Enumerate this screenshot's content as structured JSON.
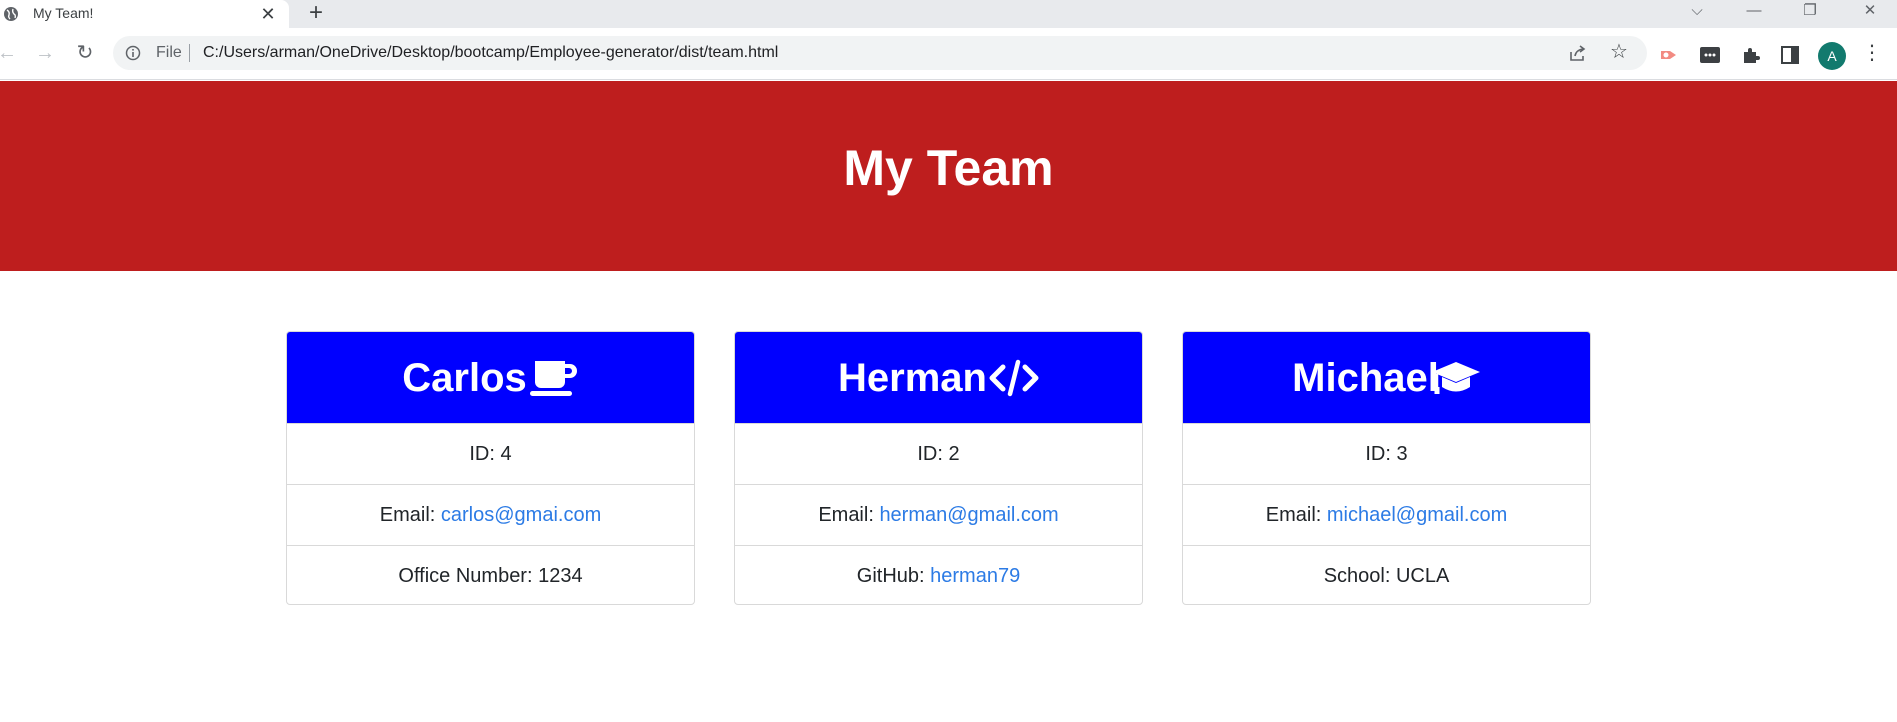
{
  "browser": {
    "tab_title": "My Team!",
    "tab_close": "✕",
    "new_tab": "+",
    "controls": {
      "tab_search": "⌵",
      "minimize": "—",
      "restore": "❐",
      "close": "✕"
    },
    "nav": {
      "back": "←",
      "forward": "→",
      "reload": "↻"
    },
    "omnibox": {
      "scheme_label": "File",
      "url": "C:/Users/arman/OneDrive/Desktop/bootcamp/Employee-generator/dist/team.html"
    },
    "star": "☆",
    "profile_initial": "A",
    "menu": "⋮"
  },
  "page": {
    "heading": "My Team",
    "cards": [
      {
        "name": "Carlos",
        "icon": "coffee-mug-icon",
        "id_text": "ID: 4",
        "email_label": "Email: ",
        "email": "carlos@gmai.com",
        "detail_label": "Office Number: 1234",
        "detail_link": ""
      },
      {
        "name": "Herman",
        "icon": "code-icon",
        "id_text": "ID: 2",
        "email_label": "Email: ",
        "email": "herman@gmail.com",
        "detail_label": "GitHub: ",
        "detail_link": "herman79"
      },
      {
        "name": "Michael",
        "icon": "graduation-cap-icon",
        "id_text": "ID: 3",
        "email_label": "Email: ",
        "email": "michael@gmail.com",
        "detail_label": "School: UCLA",
        "detail_link": ""
      }
    ]
  },
  "colors": {
    "jumbotron_bg": "#be1e1e",
    "card_header_bg": "#0000ff",
    "link": "#2c7be5"
  }
}
